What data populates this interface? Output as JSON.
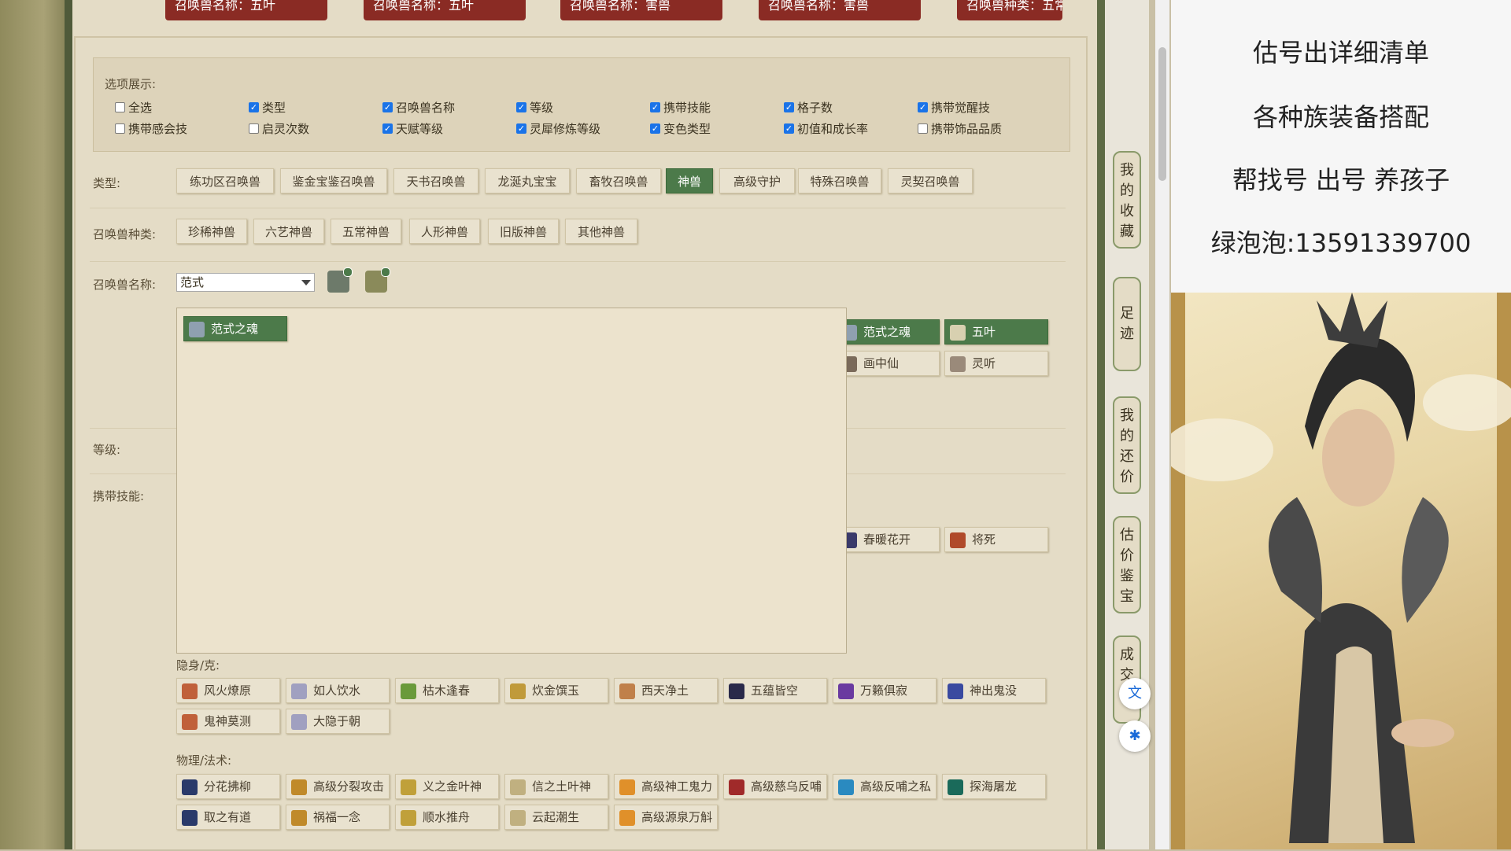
{
  "top_tabs": [
    "召唤兽名称：五叶",
    "召唤兽名称：五叶",
    "召唤兽名称：害兽",
    "召唤兽名称：害兽",
    "召唤兽种类：五常"
  ],
  "options": {
    "title": "选项展示:",
    "items": [
      {
        "label": "全选",
        "checked": false
      },
      {
        "label": "类型",
        "checked": true
      },
      {
        "label": "召唤兽名称",
        "checked": true
      },
      {
        "label": "等级",
        "checked": true
      },
      {
        "label": "携带技能",
        "checked": true
      },
      {
        "label": "格子数",
        "checked": true
      },
      {
        "label": "携带觉醒技",
        "checked": true
      },
      {
        "label": "携带感会技",
        "checked": false
      },
      {
        "label": "启灵次数",
        "checked": false
      },
      {
        "label": "天赋等级",
        "checked": true
      },
      {
        "label": "灵犀修炼等级",
        "checked": true
      },
      {
        "label": "变色类型",
        "checked": true
      },
      {
        "label": "初值和成长率",
        "checked": true
      },
      {
        "label": "携带饰品品质",
        "checked": false
      }
    ]
  },
  "type_row": {
    "label": "类型:",
    "buttons": [
      "练功区召唤兽",
      "鉴金宝鉴召唤兽",
      "天书召唤兽",
      "龙涎丸宝宝",
      "畜牧召唤兽",
      "神兽",
      "高级守护",
      "特殊召唤兽",
      "灵契召唤兽"
    ],
    "active": "神兽"
  },
  "kind_row": {
    "label": "召唤兽种类:",
    "buttons": [
      "珍稀神兽",
      "六艺神兽",
      "五常神兽",
      "人形神兽",
      "旧版神兽",
      "其他神兽"
    ]
  },
  "name_row": {
    "label": "召唤兽名称:",
    "selected": "范式"
  },
  "dropdown": {
    "item": "范式之魂"
  },
  "right_pets": [
    {
      "label": "范式之魂",
      "selected": true
    },
    {
      "label": "五叶",
      "selected": true
    },
    {
      "label": "画中仙",
      "selected": false
    },
    {
      "label": "灵听",
      "selected": false
    }
  ],
  "level_label": "等级:",
  "skill_label": "携带技能:",
  "skill_row_right": [
    "春暖花开",
    "将死"
  ],
  "stealth": {
    "label": "隐身/克:",
    "items": [
      "风火燎原",
      "如人饮水",
      "枯木逢春",
      "炊金馔玉",
      "西天净土",
      "五蕴皆空",
      "万籁俱寂",
      "神出鬼没",
      "鬼神莫测",
      "大隐于朝"
    ]
  },
  "physical": {
    "label": "物理/法术:",
    "items": [
      "分花拂柳",
      "高级分裂攻击",
      "义之金叶神",
      "信之土叶神",
      "高级神工鬼力",
      "高级慈乌反哺",
      "高级反哺之私",
      "探海屠龙",
      "取之有道",
      "祸福一念",
      "顺水推舟",
      "云起潮生",
      "高级源泉万斛"
    ]
  },
  "side_buttons": [
    "我的收藏",
    "足迹",
    "我的还价",
    "估价鉴宝",
    "成交"
  ],
  "ad": {
    "lines": [
      "估号出详细清单",
      "各种族装备搭配",
      "帮找号 出号 养孩子",
      "绿泡泡:13591339700"
    ]
  },
  "colors": {
    "accent_green": "#4c7a4a",
    "tab_red": "#8a2b24",
    "checkbox_blue": "#1a73e8"
  }
}
